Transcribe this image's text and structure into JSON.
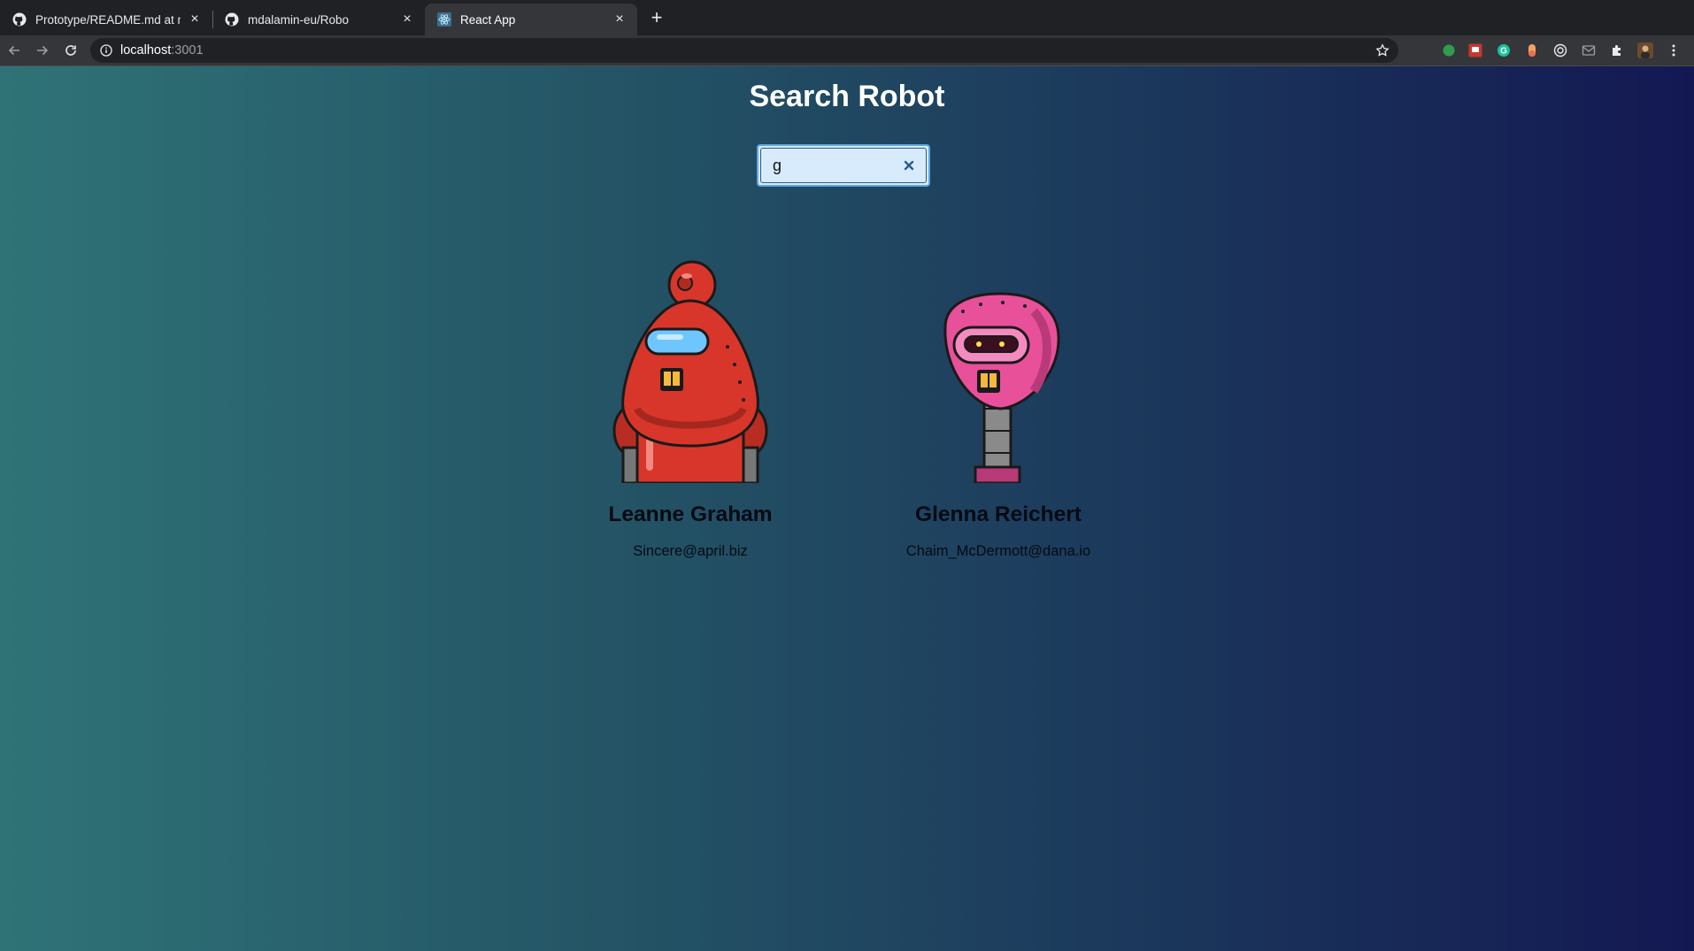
{
  "browser": {
    "tabs": [
      {
        "title": "Prototype/README.md at master",
        "favicon": "github-icon",
        "active": false
      },
      {
        "title": "mdalamin-eu/Robo",
        "favicon": "github-icon",
        "active": false
      },
      {
        "title": "React App",
        "favicon": "react-icon",
        "active": true
      }
    ],
    "address": {
      "host": "localhost",
      "port": ":3001"
    }
  },
  "app": {
    "title": "Search Robot",
    "search": {
      "value": "g",
      "placeholder": ""
    },
    "robots": [
      {
        "name": "Leanne Graham",
        "email": "Sincere@april.biz",
        "color": "#d8362a"
      },
      {
        "name": "Glenna Reichert",
        "email": "Chaim_McDermott@dana.io",
        "color": "#e8509a"
      }
    ]
  },
  "colors": {
    "gradient_start": "#2f7377",
    "gradient_end": "#131852"
  }
}
